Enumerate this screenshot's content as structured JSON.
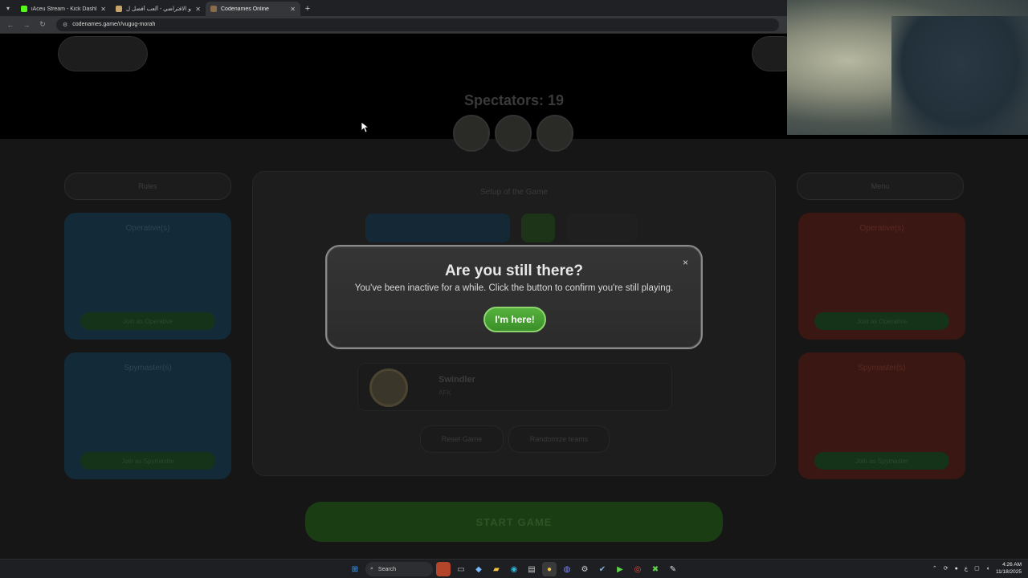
{
  "browser": {
    "tabs": [
      {
        "title": "iAceu Stream - Kick Dashboard",
        "favicon_color": "#53fc18",
        "active": false
      },
      {
        "title": "البيانو الافتراضي - ألعب أفضل ل…",
        "favicon_color": "#c9a46a",
        "active": false
      },
      {
        "title": "Codenames Online",
        "favicon_color": "#8a6b4a",
        "active": true
      }
    ],
    "new_tab": "+",
    "url": "codenames.game/r/vugug-morah"
  },
  "page": {
    "spectators_label": "Spectators: 19",
    "left_team_button": "Rules",
    "right_team_button": "Menu",
    "blue_operatives": "Operative(s)",
    "blue_spymasters": "Spymaster(s)",
    "red_operatives": "Operative(s)",
    "red_spymasters": "Spymaster(s)",
    "join_label": "Join as Operative",
    "join_spy_label": "Join as Spymaster",
    "center_title": "Setup of the Game",
    "player_name": "Swindler",
    "player_sub": "AFK",
    "small_btn_1": "Reset Game",
    "small_btn_2": "Randomize teams",
    "start_button": "START GAME"
  },
  "modal": {
    "title": "Are you still there?",
    "text": "You've been inactive for a while. Click the button to confirm you're still playing.",
    "button": "I'm here!",
    "close": "×"
  },
  "taskbar": {
    "search_label": "Search",
    "clock_time": "4:26 AM",
    "clock_date": "11/18/2025",
    "tray_lang": "ع"
  }
}
